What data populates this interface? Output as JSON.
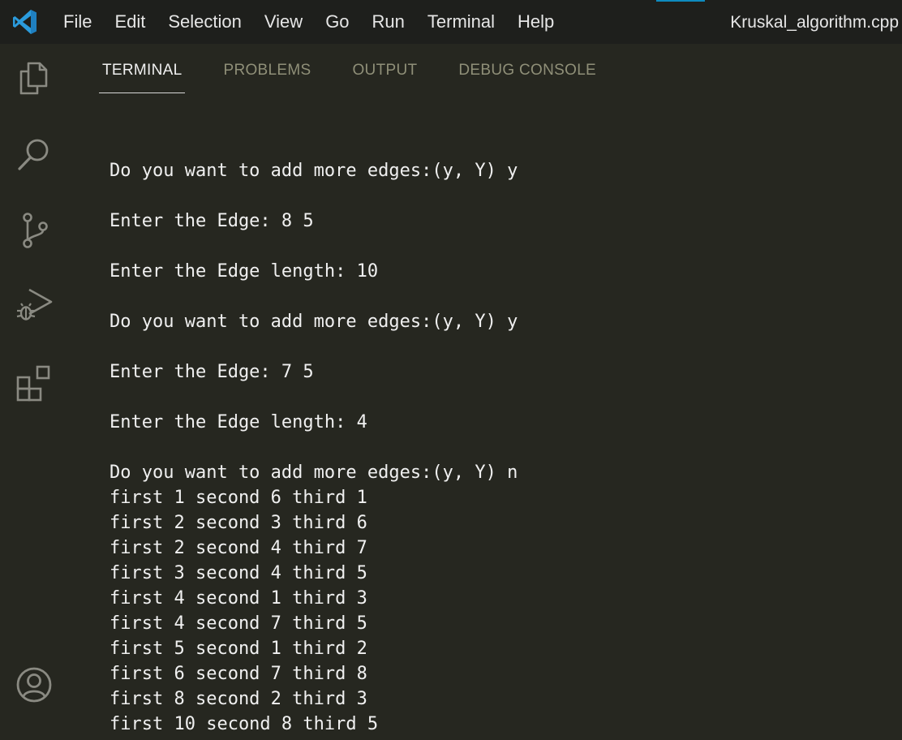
{
  "titlebar": {
    "menu": [
      "File",
      "Edit",
      "Selection",
      "View",
      "Go",
      "Run",
      "Terminal",
      "Help"
    ],
    "window_title": "Kruskal_algorithm.cpp",
    "accent_color": "#0e8bbf"
  },
  "activity_bar": {
    "icons": [
      "explorer-icon",
      "search-icon",
      "source-control-icon",
      "run-debug-icon",
      "extensions-icon",
      "account-icon"
    ]
  },
  "panel": {
    "tabs": [
      {
        "label": "TERMINAL",
        "active": true
      },
      {
        "label": "PROBLEMS",
        "active": false
      },
      {
        "label": "OUTPUT",
        "active": false
      },
      {
        "label": "DEBUG CONSOLE",
        "active": false
      }
    ]
  },
  "terminal": {
    "lines": [
      "",
      "Do you want to add more edges:(y, Y) y",
      "",
      "Enter the Edge: 8 5",
      "",
      "Enter the Edge length: 10",
      "",
      "Do you want to add more edges:(y, Y) y",
      "",
      "Enter the Edge: 7 5",
      "",
      "Enter the Edge length: 4",
      "",
      "Do you want to add more edges:(y, Y) n",
      "first 1 second 6 third 1",
      "first 2 second 3 third 6",
      "first 2 second 4 third 7",
      "first 3 second 4 third 5",
      "first 4 second 1 third 3",
      "first 4 second 7 third 5",
      "first 5 second 1 third 2",
      "first 6 second 7 third 8",
      "first 8 second 2 third 3",
      "first 10 second 8 third 5"
    ]
  }
}
